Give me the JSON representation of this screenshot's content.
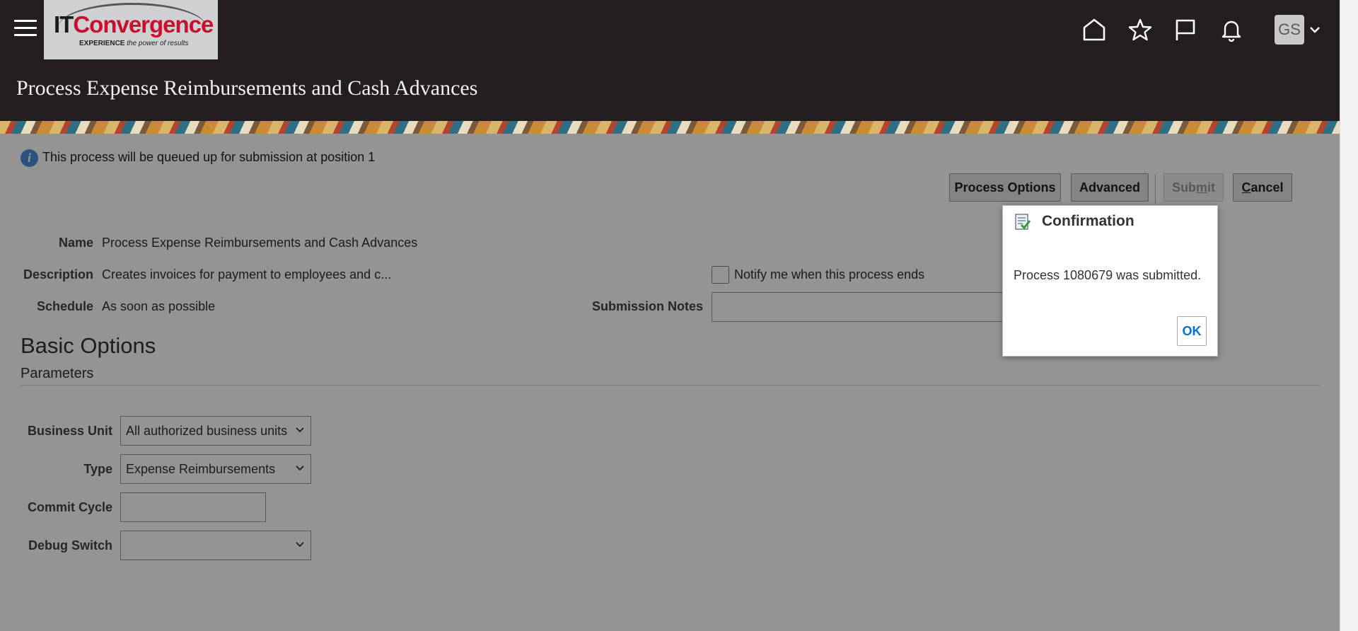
{
  "header": {
    "logo": {
      "brand_it": "IT",
      "brand_rest": "Convergence",
      "tagline_bold": "EXPERIENCE",
      "tagline_rest": " the power of results"
    },
    "page_title": "Process Expense Reimbursements and Cash Advances",
    "icons": [
      "home-icon",
      "star-icon",
      "flag-icon",
      "bell-icon"
    ],
    "user_initials": "GS"
  },
  "info": {
    "message": "This process will be queued up for submission at position 1"
  },
  "toolbar": {
    "process_options": "Process Options",
    "advanced": "Advanced",
    "submit": {
      "pre": "Sub",
      "mn": "m",
      "post": "it"
    },
    "cancel": {
      "mn": "C",
      "post": "ancel"
    }
  },
  "form": {
    "name_label": "Name",
    "name_value": "Process Expense Reimbursements and Cash Advances",
    "description_label": "Description",
    "description_value": "Creates invoices for payment to employees and c...",
    "schedule_label": "Schedule",
    "schedule_value": "As soon as possible",
    "notify_label": "Notify me when this process ends",
    "notify_checked": false,
    "submission_notes_label": "Submission Notes",
    "submission_notes_value": ""
  },
  "basic_options": {
    "title": "Basic Options",
    "parameters_title": "Parameters",
    "business_unit": {
      "label": "Business Unit",
      "value": "All authorized business units"
    },
    "type": {
      "label": "Type",
      "value": "Expense Reimbursements"
    },
    "commit_cycle": {
      "label": "Commit Cycle",
      "value": ""
    },
    "debug_switch": {
      "label": "Debug Switch",
      "value": ""
    }
  },
  "dialog": {
    "title": "Confirmation",
    "message": "Process 1080679 was submitted.",
    "ok": "OK"
  },
  "colors": {
    "header_bg": "#231f20",
    "ok_text": "#0572ce",
    "overlay": "rgba(0,0,0,0.42)"
  }
}
